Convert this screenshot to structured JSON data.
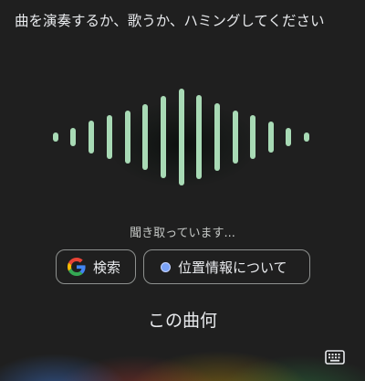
{
  "prompt": "曲を演奏するか、歌うか、ハミングしてください",
  "status": "聞き取っています...",
  "chips": {
    "search_label": "検索",
    "location_label": "位置情報について"
  },
  "title": "この曲何",
  "icons": {
    "search_chip": "google-g-icon",
    "location_chip": "location-dot-icon",
    "keyboard": "keyboard-icon"
  },
  "colors": {
    "background": "#1f1f1f",
    "waveform": "#a8dab5",
    "chip_border": "#8e918f",
    "location_dot": "#7aa2f7"
  }
}
